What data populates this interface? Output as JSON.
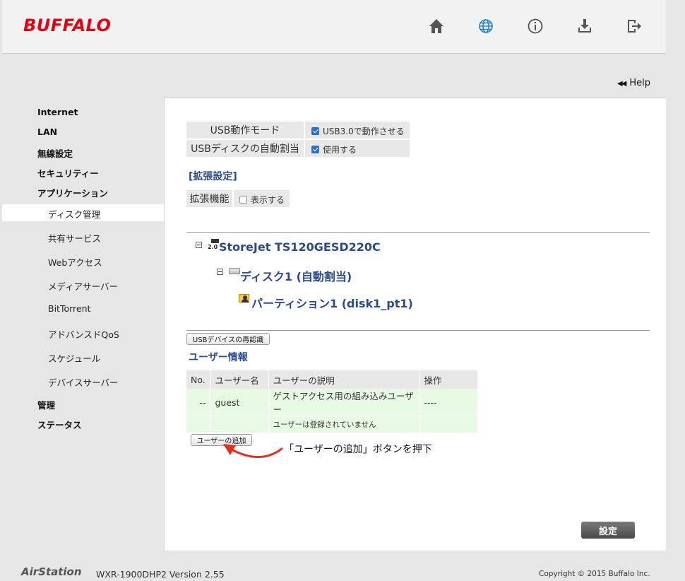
{
  "header": {
    "logo": "BUFFALO",
    "icons": [
      "home-icon",
      "globe-icon",
      "info-icon",
      "download-icon",
      "logout-icon"
    ]
  },
  "help": {
    "label": "Help"
  },
  "sidebar": {
    "items": [
      {
        "label": "Internet"
      },
      {
        "label": "LAN"
      },
      {
        "label": "無線設定"
      },
      {
        "label": "セキュリティー"
      },
      {
        "label": "アプリケーション"
      }
    ],
    "sub_items": [
      {
        "label": "ディスク管理",
        "active": true
      },
      {
        "label": "共有サービス"
      },
      {
        "label": "Webアクセス"
      },
      {
        "label": "メディアサーバー"
      },
      {
        "label": "BitTorrent"
      },
      {
        "label": "アドバンスドQoS"
      },
      {
        "label": "スケジュール"
      },
      {
        "label": "デバイスサーバー"
      }
    ],
    "bottom_items": [
      {
        "label": "管理"
      },
      {
        "label": "ステータス"
      }
    ]
  },
  "settings": {
    "usb_mode_label": "USB動作モード",
    "usb_mode_option": "USB3.0で動作させる",
    "usb_mode_checked": true,
    "auto_assign_label": "USBディスクの自動割当",
    "auto_assign_option": "使用する",
    "auto_assign_checked": true
  },
  "advanced": {
    "title": "[拡張設定]",
    "feature_label": "拡張機能",
    "feature_option": "表示する",
    "feature_checked": false
  },
  "tree": {
    "device_badge": "2.0",
    "device": "StoreJet TS120GESD220C",
    "disk": "ディスク1 (自動割当)",
    "partition": "パーティション1 (disk1_pt1)"
  },
  "usb_redetect_button": "USBデバイスの再認識",
  "users": {
    "title": "ユーザー情報",
    "headers": [
      "No.",
      "ユーザー名",
      "ユーザーの説明",
      "操作"
    ],
    "rows": [
      [
        "--",
        "guest",
        "ゲストアクセス用の組み込みユーザー",
        "----"
      ]
    ],
    "empty_message": "ユーザーは登録されていません",
    "add_button": "ユーザーの追加"
  },
  "annotation": "「ユーザーの追加」ボタンを押下",
  "submit_button": "設定",
  "footer": {
    "brand": "AirStation",
    "model": "WXR-1900DHP2   Version 2.55",
    "copyright": "Copyright © 2015 Buffalo Inc."
  },
  "colors": {
    "brand_red": "#e60012",
    "heading_blue": "#2a4a8a",
    "checkbox_blue": "#2a6fd6",
    "annotation_arrow": "#e03020"
  }
}
